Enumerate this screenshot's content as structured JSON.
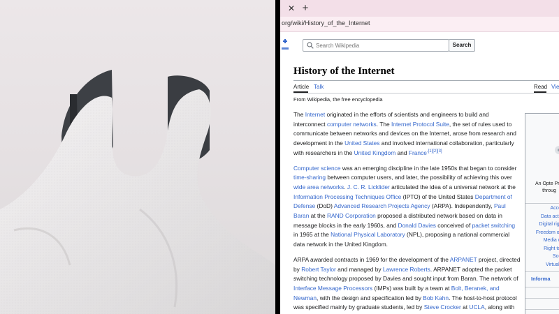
{
  "browser": {
    "tab_close_glyph": "✕",
    "new_tab_glyph": "+",
    "url": "org/wiki/History_of_the_Internet"
  },
  "wiki": {
    "search_placeholder": "Search Wikipedia",
    "search_button": "Search",
    "title": "History of the Internet",
    "tabs": {
      "article": "Article",
      "talk": "Talk",
      "read": "Read",
      "view": "Vie"
    },
    "tagline": "From Wikipedia, the free encyclopedia",
    "paragraphs": [
      [
        {
          "t": "The "
        },
        {
          "t": "Internet",
          "link": true
        },
        {
          "t": " originated in the efforts of scientists and engineers to build and interconnect "
        },
        {
          "t": "computer networks",
          "link": true
        },
        {
          "t": ". The "
        },
        {
          "t": "Internet Protocol Suite",
          "link": true
        },
        {
          "t": ", the set of rules used to communicate between networks and devices on the Internet, arose from research and development in the "
        },
        {
          "t": "United States",
          "link": true
        },
        {
          "t": " and involved international collaboration, particularly with researchers in the "
        },
        {
          "t": "United Kingdom",
          "link": true
        },
        {
          "t": " and "
        },
        {
          "t": "France",
          "link": true
        },
        {
          "t": ".[1][2][3]",
          "sup": true
        }
      ],
      [
        {
          "t": "Computer science",
          "link": true
        },
        {
          "t": " was an emerging discipline in the late 1950s that began to consider "
        },
        {
          "t": "time-sharing",
          "link": true
        },
        {
          "t": " between computer users, and later, the possibility of achieving this over "
        },
        {
          "t": "wide area networks",
          "link": true
        },
        {
          "t": ". "
        },
        {
          "t": "J. C. R. Licklider",
          "link": true
        },
        {
          "t": " articulated the idea of a universal network at the "
        },
        {
          "t": "Information Processing Techniques Office",
          "link": true
        },
        {
          "t": " (IPTO) of the United States "
        },
        {
          "t": "Department of Defense",
          "link": true
        },
        {
          "t": " (DoD) "
        },
        {
          "t": "Advanced Research Projects Agency",
          "link": true
        },
        {
          "t": " (ARPA). Independently, "
        },
        {
          "t": "Paul Baran",
          "link": true
        },
        {
          "t": " at the "
        },
        {
          "t": "RAND Corporation",
          "link": true
        },
        {
          "t": " proposed a distributed network based on data in message blocks in the early 1960s, and "
        },
        {
          "t": "Donald Davies",
          "link": true
        },
        {
          "t": " conceived of "
        },
        {
          "t": "packet switching",
          "link": true
        },
        {
          "t": " in 1965 at the "
        },
        {
          "t": "National Physical Laboratory",
          "link": true
        },
        {
          "t": " (NPL), proposing a national commercial data network in the United Kingdom."
        }
      ],
      [
        {
          "t": "ARPA awarded contracts in 1969 for the development of the "
        },
        {
          "t": "ARPANET",
          "link": true
        },
        {
          "t": " project, directed by "
        },
        {
          "t": "Robert Taylor",
          "link": true
        },
        {
          "t": " and managed by "
        },
        {
          "t": "Lawrence Roberts",
          "link": true
        },
        {
          "t": ". ARPANET adopted the packet switching technology proposed by Davies and sought input from Baran. The network of "
        },
        {
          "t": "Interface Message Processors",
          "link": true
        },
        {
          "t": " (IMPs) was built by a team at "
        },
        {
          "t": "Bolt, Beranek, and Newman",
          "link": true
        },
        {
          "t": ", with the design and specification led by "
        },
        {
          "t": "Bob Kahn",
          "link": true
        },
        {
          "t": ". The host-to-host protocol was specified mainly by graduate students, led by "
        },
        {
          "t": "Steve Crocker",
          "link": true
        },
        {
          "t": " at "
        },
        {
          "t": "UCLA",
          "link": true
        },
        {
          "t": ", along with"
        }
      ]
    ],
    "infobox": {
      "caption": "An Opte Proj\nthroug",
      "links": [
        "Access",
        "Data activis",
        "Digital rights",
        "Freedom of in",
        "Media cap",
        "Right to In",
        "Sociol",
        "Virtual co"
      ],
      "section_head": "Informa"
    }
  }
}
